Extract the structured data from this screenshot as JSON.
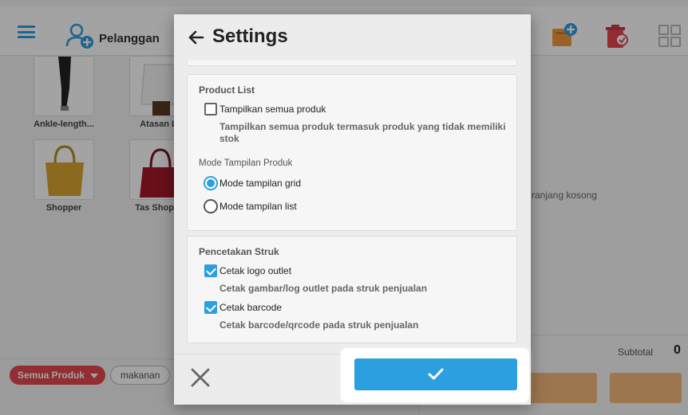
{
  "topbar": {
    "menu_icon": "hamburger-menu-icon",
    "customer_icon": "add-person-icon",
    "customer_label": "Pelanggan",
    "right_icons": [
      "add-cart-icon",
      "clear-cart-icon",
      "grid-view-icon"
    ]
  },
  "products": [
    {
      "name": "Ankle-length..."
    },
    {
      "name": "Atasan Li"
    },
    {
      "name": "Shopper"
    },
    {
      "name": "Tas Shoppe"
    }
  ],
  "cart": {
    "empty_text": "ranjang kosong",
    "subtotal_label": "Subtotal",
    "subtotal_value": "0"
  },
  "filters": {
    "all_label": "Semua Produk",
    "chip_label": "makanan"
  },
  "dialog": {
    "title": "Settings",
    "product_list": {
      "title": "Product List",
      "show_all_label": "Tampilkan semua produk",
      "show_all_checked": false,
      "show_all_desc": "Tampilkan semua produk termasuk produk yang tidak memiliki stok",
      "mode_title": "Mode Tampilan Produk",
      "mode_grid_label": "Mode tampilan grid",
      "mode_list_label": "Mode tampilan list",
      "selected_mode": "grid"
    },
    "receipt": {
      "title": "Pencetakan Struk",
      "print_logo_label": "Cetak logo outlet",
      "print_logo_checked": true,
      "print_logo_desc": "Cetak gambar/log outlet pada struk penjualan",
      "print_barcode_label": "Cetak barcode",
      "print_barcode_checked": true,
      "print_barcode_desc": "Cetak barcode/qrcode pada struk penjualan"
    }
  },
  "colors": {
    "accent": "#2b9fe0",
    "chip_red": "#e5474f"
  }
}
